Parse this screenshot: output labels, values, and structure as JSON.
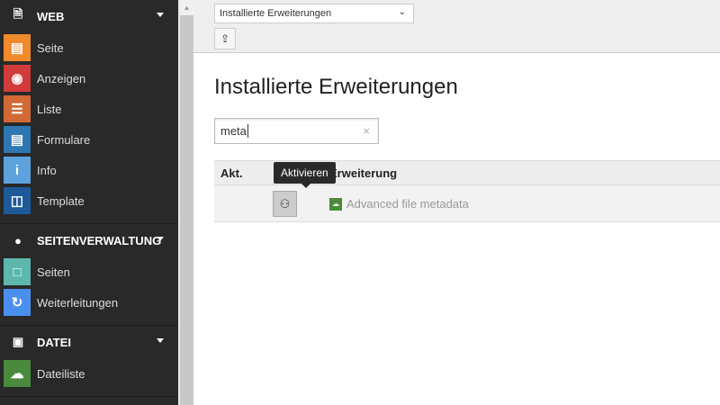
{
  "sidebar": {
    "groups": [
      {
        "label": "WEB",
        "icon": "page-icon",
        "items": [
          {
            "label": "Seite",
            "icon": "page-icon",
            "color": "#f08a2b"
          },
          {
            "label": "Anzeigen",
            "icon": "eye-icon",
            "color": "#d13b3b"
          },
          {
            "label": "Liste",
            "icon": "list-icon",
            "color": "#d26a35"
          },
          {
            "label": "Formulare",
            "icon": "form-icon",
            "color": "#2f77b3"
          },
          {
            "label": "Info",
            "icon": "info-icon",
            "color": "#5ca3dd"
          },
          {
            "label": "Template",
            "icon": "template-icon",
            "color": "#1d5a9a"
          }
        ]
      },
      {
        "label": "SEITENVERWALTUNG",
        "icon": "globe-icon",
        "items": [
          {
            "label": "Seiten",
            "icon": "monitor-icon",
            "color": "#5cb8ac"
          },
          {
            "label": "Weiterleitungen",
            "icon": "redirect-icon",
            "color": "#4a8ff0"
          }
        ]
      },
      {
        "label": "DATEI",
        "icon": "image-icon",
        "items": [
          {
            "label": "Dateiliste",
            "icon": "cloud-icon",
            "color": "#4a8a3c"
          }
        ]
      }
    ]
  },
  "toolbar": {
    "select_value": "Installierte Erweiterungen"
  },
  "main": {
    "title": "Installierte Erweiterungen",
    "search_value": "meta",
    "table": {
      "headers": [
        "Akt.",
        "Erweiterung"
      ],
      "tooltip": "Aktivieren",
      "rows": [
        {
          "name": "Advanced file metadata"
        }
      ]
    }
  }
}
